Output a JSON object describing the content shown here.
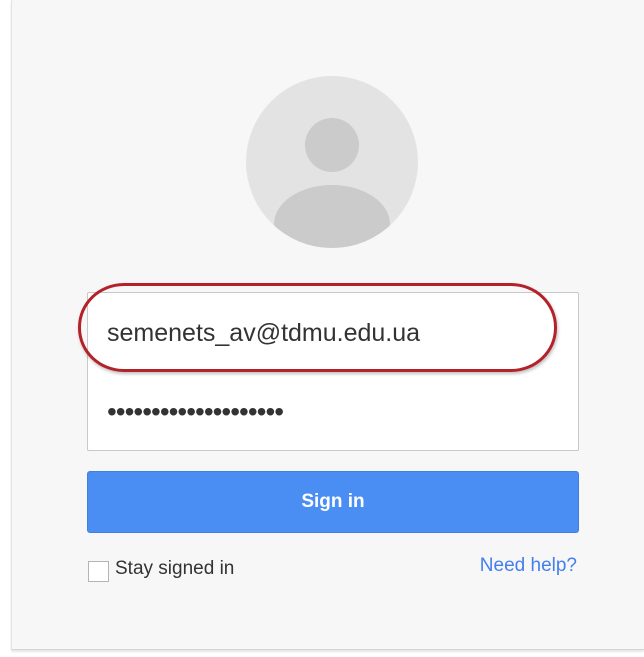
{
  "login": {
    "email_value": "semenets_av@tdmu.edu.ua",
    "password_value": "••••••••••••••••••••",
    "signin_label": "Sign in",
    "stay_signed_in_label": "Stay signed in",
    "stay_signed_in_checked": false,
    "help_link": "Need help?"
  },
  "colors": {
    "card_background": "#f7f7f7",
    "avatar_background": "#e3e3e3",
    "avatar_figure": "#cbcbcb",
    "primary_button": "#4a8df3",
    "link": "#427fed",
    "highlight_ring": "#b22228"
  },
  "icons": {
    "avatar": "default-user-avatar-icon"
  }
}
